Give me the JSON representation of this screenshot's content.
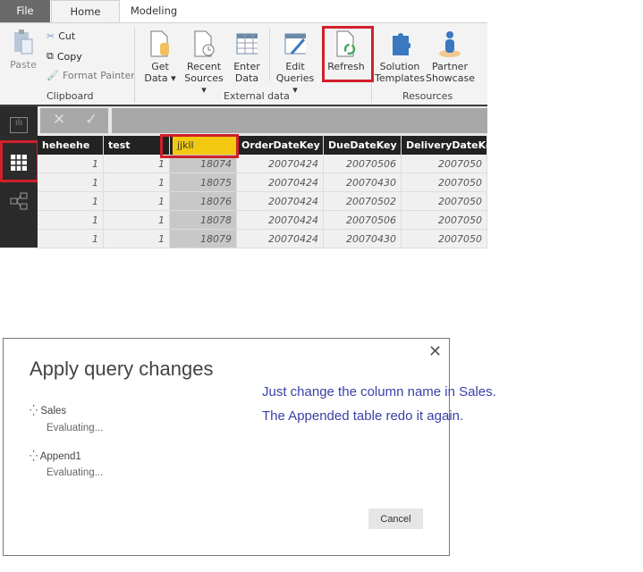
{
  "tabs": [
    {
      "label": "File"
    },
    {
      "label": "Home"
    },
    {
      "label": "Modeling"
    }
  ],
  "ribbon": {
    "clipboard": {
      "paste": "Paste",
      "cut": "Cut",
      "copy": "Copy",
      "format_painter": "Format Painter",
      "group": "Clipboard"
    },
    "external": {
      "get_data": [
        "Get",
        "Data ▾"
      ],
      "recent": [
        "Recent",
        "Sources ▾"
      ],
      "enter": [
        "Enter",
        "Data"
      ],
      "edit": [
        "Edit",
        "Queries ▾"
      ],
      "refresh": "Refresh",
      "group": "External data"
    },
    "resources": {
      "solution": [
        "Solution",
        "Templates"
      ],
      "partner": [
        "Partner",
        "Showcase"
      ],
      "group": "Resources"
    }
  },
  "table": {
    "columns": [
      "heheehe",
      "test",
      "jjkll",
      "OrderDateKey",
      "DueDateKey",
      "DeliveryDateKey"
    ],
    "rows": [
      [
        "1",
        "1",
        "18074",
        "20070424",
        "20070506",
        "2007050"
      ],
      [
        "1",
        "1",
        "18075",
        "20070424",
        "20070430",
        "2007050"
      ],
      [
        "1",
        "1",
        "18076",
        "20070424",
        "20070502",
        "2007050"
      ],
      [
        "1",
        "1",
        "18078",
        "20070424",
        "20070506",
        "2007050"
      ],
      [
        "1",
        "1",
        "18079",
        "20070424",
        "20070430",
        "2007050"
      ]
    ]
  },
  "dialog": {
    "title": "Apply query changes",
    "queries": [
      {
        "name": "Sales",
        "status": "Evaluating..."
      },
      {
        "name": "Append1",
        "status": "Evaluating..."
      }
    ],
    "cancel": "Cancel"
  },
  "annotation": [
    "Just change the column name in Sales.",
    "The Appended table redo it again."
  ],
  "colors": {
    "highlight": "#d0202a",
    "selected_column": "#f2c811",
    "annotation": "#3b3fa6"
  }
}
